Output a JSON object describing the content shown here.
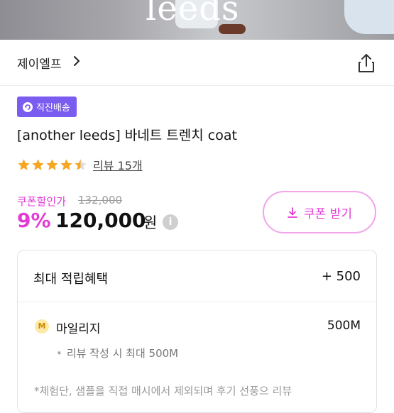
{
  "hero": {
    "watermark": "leeds"
  },
  "shop": {
    "name": "제이엘프"
  },
  "badge": {
    "label": "직진배송"
  },
  "product": {
    "title": "[another leeds] 바네트 트렌치 coat",
    "rating": 4.5,
    "review_label": "리뷰 15개"
  },
  "price": {
    "coupon_label": "쿠폰할인가",
    "original": "132,000",
    "discount": "9%",
    "current": "120,000",
    "unit": "원",
    "info_icon": "i"
  },
  "coupon_button": {
    "label": "쿠폰 받기"
  },
  "points": {
    "header_label": "최대 적립혜택",
    "header_value": "+ 500",
    "mileage_icon": "M",
    "mileage_label": "마일리지",
    "mileage_value": "500M",
    "mileage_note": "리뷰 작성 시 최대 500M"
  },
  "notice": {
    "text": "*체험단, 샘플을 직접 매시에서 제외되며 후기 선풍으 리뷰"
  },
  "colors": {
    "accent": "#e23bd6",
    "badge": "#7b5cf0",
    "star": "#f5a623"
  }
}
